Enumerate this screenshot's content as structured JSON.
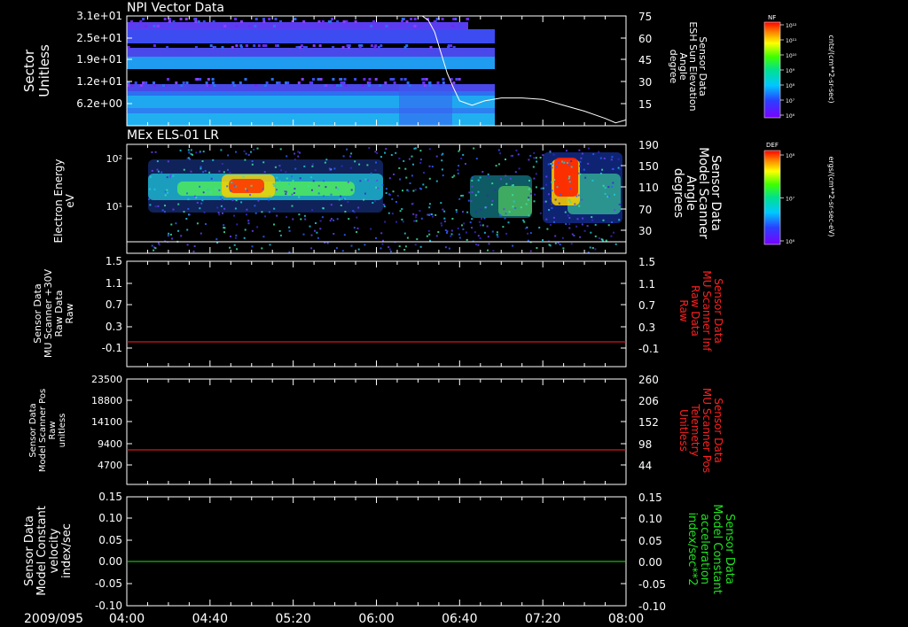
{
  "date_label": "2009/095",
  "x_ticks": [
    "04:00",
    "04:40",
    "05:20",
    "06:00",
    "06:40",
    "07:20",
    "08:00"
  ],
  "panel1": {
    "title": "NPI Vector Data",
    "ylabel": [
      "Sector",
      "Unitless"
    ],
    "yticks": [
      "3.1e+01",
      "2.5e+01",
      "1.9e+01",
      "1.2e+01",
      "6.2e+00"
    ],
    "rticks": [
      "75",
      "60",
      "45",
      "30",
      "15"
    ],
    "rlabel": [
      "Sensor Data",
      "ESH Sun Elevation",
      "Angle",
      "degree"
    ],
    "cbar_title": "NF",
    "cbar_ticks": [
      "10¹²",
      "10¹¹",
      "10¹⁰",
      "10⁹",
      "10⁸",
      "10⁷",
      "10⁶"
    ],
    "cbar_units": "cnts/(cm**2-sr-sec)"
  },
  "panel2": {
    "title": "MEx ELS-01 LR",
    "ylabel": [
      "Electron Energy",
      "eV"
    ],
    "yticks": [
      "10²",
      "10¹"
    ],
    "rticks": [
      "190",
      "150",
      "110",
      "70",
      "30"
    ],
    "rlabel": [
      "Sensor Data",
      "Model Scanner",
      "Angle",
      "degrees"
    ],
    "cbar_title": "DEF",
    "cbar_ticks": [
      "10⁸",
      "10⁷",
      "10⁶"
    ],
    "cbar_units": "ergs/(cm**2-sr-sec-eV)"
  },
  "panel3": {
    "ylabel": [
      "Sensor Data",
      "MU Scanner +30V",
      "Raw Data",
      "Raw"
    ],
    "yticks": [
      "1.5",
      "1.1",
      "0.7",
      "0.3",
      "-0.1"
    ],
    "rticks": [
      "1.5",
      "1.1",
      "0.7",
      "0.3",
      "-0.1"
    ],
    "rlabel": [
      "Sensor Data",
      "MU Scanner Inf",
      "Raw Data",
      "Raw"
    ]
  },
  "panel4": {
    "ylabel": [
      "Sensor Data",
      "Model Scanner Pos",
      "Raw",
      "unitless"
    ],
    "yticks": [
      "23500",
      "18800",
      "14100",
      "9400",
      "4700"
    ],
    "rticks": [
      "260",
      "206",
      "152",
      "98",
      "44"
    ],
    "rlabel": [
      "Sensor Data",
      "MU Scanner Pos",
      "Telemetry",
      "Unitless"
    ]
  },
  "panel5": {
    "ylabel": [
      "Sensor Data",
      "Model Constant",
      "velocity",
      "index/sec"
    ],
    "yticks": [
      "0.15",
      "0.10",
      "0.05",
      "0.00",
      "-0.05",
      "-0.10"
    ],
    "rticks": [
      "0.15",
      "0.10",
      "0.05",
      "0.00",
      "-0.05",
      "-0.10"
    ],
    "rlabel": [
      "Sensor Data",
      "Model Constant",
      "acceleration",
      "index/sec**2"
    ]
  },
  "colors": {
    "red_trace": "#ff2020",
    "green_trace": "#20e020",
    "white_trace": "#ffffff"
  },
  "chart_data": [
    {
      "type": "heatmap",
      "title": "NPI Vector Data",
      "xlabel": "",
      "ylabel": "Sector Unitless",
      "x_range": [
        "04:00",
        "08:00"
      ],
      "yticks": [
        31,
        25,
        19,
        12,
        6.2
      ],
      "data_end_time": "06:53",
      "overlay_line": {
        "name": "Sensor Data ESH Sun Elevation Angle",
        "units": "degree",
        "x": [
          "06:22",
          "06:25",
          "06:28",
          "06:31",
          "06:34",
          "06:37",
          "06:40",
          "06:46",
          "06:52",
          "07:00",
          "07:10",
          "07:20",
          "07:30",
          "07:40",
          "07:50",
          "07:55",
          "08:00"
        ],
        "y": [
          75,
          72,
          64,
          50,
          36,
          26,
          17,
          14,
          17,
          19,
          19,
          18,
          14,
          10,
          5,
          2,
          4
        ]
      }
    },
    {
      "type": "heatmap",
      "title": "MEx ELS-01 LR",
      "ylabel": "Electron Energy eV",
      "x_range": [
        "04:00",
        "08:00"
      ],
      "yscale": "log",
      "ylim": [
        2,
        150
      ],
      "overlay_line": {
        "name": "Sensor Data Model Scanner Angle",
        "units": "degrees",
        "value": 16
      }
    },
    {
      "type": "line",
      "series": [
        {
          "name": "Sensor Data MU Scanner Inf Raw Data",
          "x": [
            "04:00",
            "08:00"
          ],
          "y": [
            0.0,
            0.0
          ]
        }
      ],
      "ylim": [
        -0.3,
        1.5
      ]
    },
    {
      "type": "line",
      "series": [
        {
          "name": "Sensor Data MU Scanner Pos Telemetry",
          "x": [
            "04:00",
            "08:00"
          ],
          "y": [
            84,
            84
          ]
        }
      ],
      "ylim_left": [
        0,
        23500
      ],
      "ylim_right": [
        0,
        260
      ]
    },
    {
      "type": "line",
      "series": [
        {
          "name": "Sensor Data Model Constant acceleration",
          "x": [
            "04:00",
            "08:00"
          ],
          "y": [
            0.0,
            0.0
          ]
        }
      ],
      "ylim": [
        -0.1,
        0.15
      ]
    }
  ]
}
